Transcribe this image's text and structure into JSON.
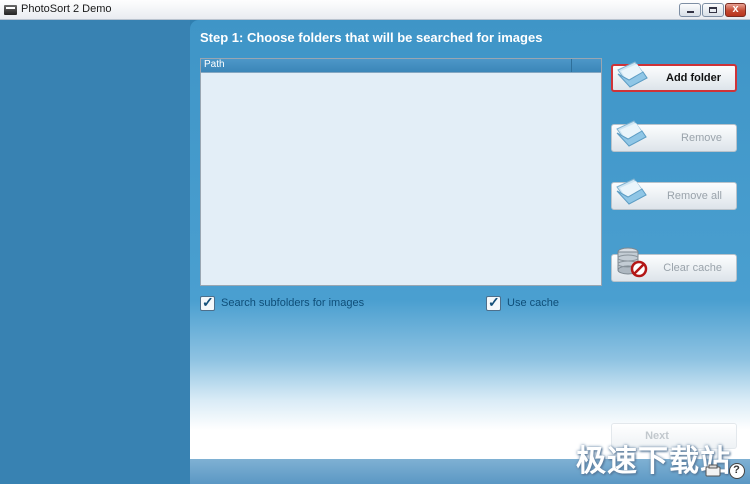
{
  "window": {
    "title": "PhotoSort 2 Demo",
    "minimize_label": "_",
    "maximize_label": "□",
    "close_label": "x"
  },
  "step": {
    "heading": "Step 1:  Choose folders that will be searched for images"
  },
  "folder_list": {
    "column_header": "Path",
    "rows": []
  },
  "actions": {
    "add_folder": "Add folder",
    "remove": "Remove",
    "remove_all": "Remove all",
    "clear_cache": "Clear cache"
  },
  "options": {
    "search_subfolders": {
      "label": "Search subfolders for images",
      "checked": true
    },
    "use_cache": {
      "label": "Use cache",
      "checked": true
    }
  },
  "navigation": {
    "next": "Next"
  },
  "footer": {
    "help_label": "?",
    "watermark": "极速下载站"
  },
  "icons": {
    "add_folder": "folder-icon",
    "remove": "folder-icon",
    "remove_all": "folder-icon",
    "clear_cache": "database-no-icon",
    "help": "question-icon"
  },
  "colors": {
    "panel_blue": "#3f95c7",
    "sidebar_blue": "#3882b2",
    "highlight_red": "#cf3338"
  }
}
